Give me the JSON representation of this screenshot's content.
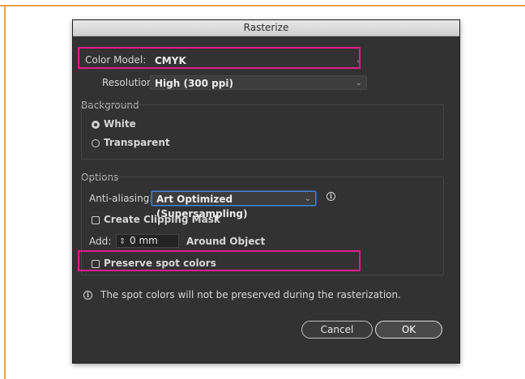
{
  "dialog": {
    "title": "Rasterize",
    "color_model": {
      "label": "Color Model:",
      "value": "CMYK"
    },
    "resolution": {
      "label": "Resolution:",
      "value": "High (300 ppi)"
    },
    "background": {
      "section_label": "Background",
      "options": [
        {
          "label": "White",
          "selected": true
        },
        {
          "label": "Transparent",
          "selected": false
        }
      ]
    },
    "options": {
      "section_label": "Options",
      "anti_aliasing": {
        "label": "Anti-aliasing:",
        "value": "Art Optimized (Supersampling)"
      },
      "create_clipping_mask": {
        "label": "Create Clipping Mask",
        "checked": false
      },
      "add": {
        "label": "Add:",
        "value": "0 mm",
        "suffix": "Around Object"
      },
      "preserve_spot_colors": {
        "label": "Preserve spot colors",
        "checked": false
      }
    },
    "info_message": "The spot colors will not be preserved during the rasterization.",
    "buttons": {
      "cancel": "Cancel",
      "ok": "OK"
    }
  },
  "colors": {
    "highlight": "#e21d8b",
    "dialog_bg": "#323232",
    "frame": "#e8a24a"
  }
}
